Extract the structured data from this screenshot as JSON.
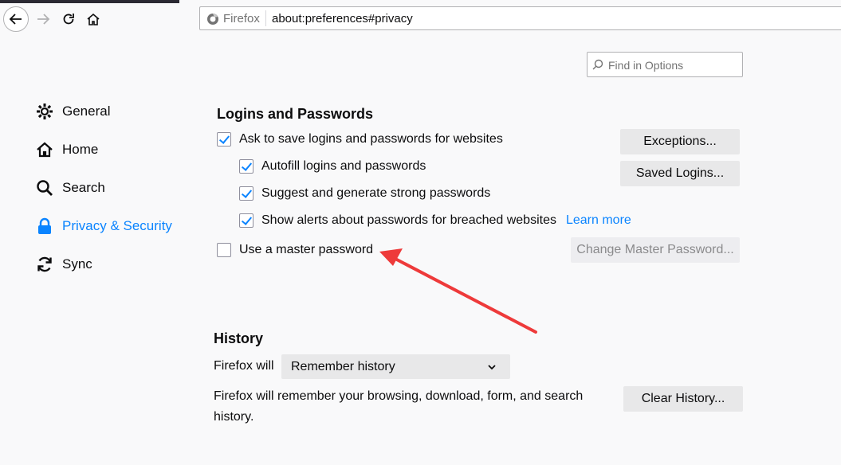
{
  "browser": {
    "identity_label": "Firefox",
    "url": "about:preferences#privacy"
  },
  "search": {
    "placeholder": "Find in Options"
  },
  "sidebar": {
    "items": [
      {
        "label": "General",
        "icon": "gear-icon"
      },
      {
        "label": "Home",
        "icon": "home-icon"
      },
      {
        "label": "Search",
        "icon": "search-icon"
      },
      {
        "label": "Privacy & Security",
        "icon": "lock-icon",
        "active": true
      },
      {
        "label": "Sync",
        "icon": "sync-icon"
      }
    ]
  },
  "logins": {
    "title": "Logins and Passwords",
    "ask_save": {
      "label": "Ask to save logins and passwords for websites",
      "checked": true
    },
    "autofill": {
      "label": "Autofill logins and passwords",
      "checked": true
    },
    "suggest": {
      "label": "Suggest and generate strong passwords",
      "checked": true
    },
    "alerts": {
      "label": "Show alerts about passwords for breached websites",
      "checked": true
    },
    "learn_more": "Learn more",
    "master": {
      "label": "Use a master password",
      "checked": false
    },
    "exceptions_button": "Exceptions...",
    "saved_logins_button": "Saved Logins...",
    "change_master_button": "Change Master Password..."
  },
  "history": {
    "title": "History",
    "firefox_will_label": "Firefox will",
    "mode_selected": "Remember history",
    "description": "Firefox will remember your browsing, download, form, and search history.",
    "clear_button": "Clear History..."
  },
  "colors": {
    "accent": "#0a84ff",
    "annotation_arrow": "#ee3a3a"
  }
}
